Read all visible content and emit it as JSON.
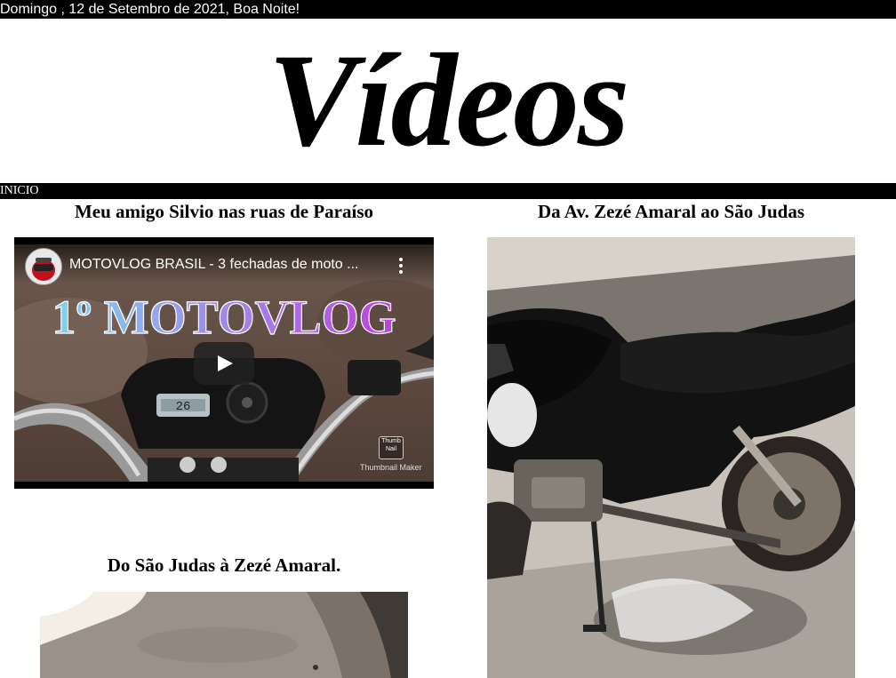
{
  "header": {
    "greeting": "Domingo , 12 de Setembro de 2021, Boa Noite!",
    "title": "Vídeos"
  },
  "nav": {
    "home_label": "INICIO"
  },
  "videos": [
    {
      "title": "Meu amigo Silvio nas ruas de Paraíso",
      "player": {
        "video_title": "MOTOVLOG BRASIL - 3 fechadas de moto ...",
        "overlay_text": "1º MOTOVLOG",
        "speedometer": "26",
        "watermark_logo": "Thumb Nail",
        "watermark": "Thumbnail Maker",
        "play_icon": "play-icon",
        "menu_icon": "more-vert-icon"
      }
    },
    {
      "title": "Da Av. Zezé Amaral ao São Judas"
    },
    {
      "title": "Do São Judas à Zezé Amaral."
    }
  ],
  "colors": {
    "bar_background": "#000000",
    "bar_text": "#ffffff",
    "page_background": "#ffffff",
    "overlay_gradient_start": "#7fd4f0",
    "overlay_gradient_end": "#c040e0"
  }
}
